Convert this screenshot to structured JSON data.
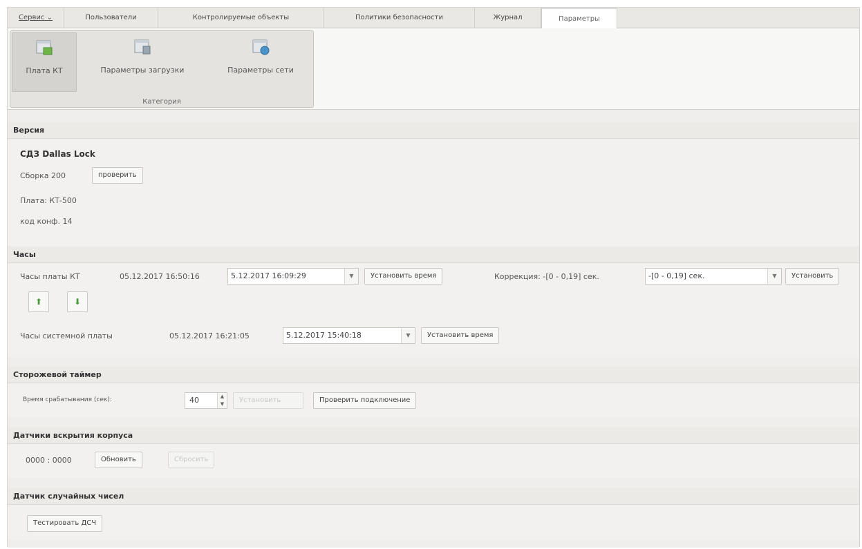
{
  "tabs": {
    "service": "Сервис",
    "users": "Пользователи",
    "objects": "Контролируемые объекты",
    "policies": "Политики безопасности",
    "journal": "Журнал",
    "params": "Параметры"
  },
  "ribbon": {
    "btn_board": "Плата КТ",
    "btn_boot": "Параметры загрузки",
    "btn_net": "Параметры сети",
    "group_caption": "Категория"
  },
  "version": {
    "title": "Версия",
    "product": "СДЗ Dallas Lock",
    "build": "Сборка 200",
    "check_button": "проверить",
    "board": "Плата: КТ-500",
    "config_code": "код конф. 14"
  },
  "clock": {
    "title": "Часы",
    "board_label": "Часы платы КТ",
    "board_time": "05.12.2017 16:50:16",
    "board_combo_value": "5.12.2017 16:09:29",
    "set_time_button": "Установить время",
    "correction_label": "Коррекция: -[0 - 0,19] сек.",
    "correction_combo_value": "-[0 - 0,19] сек.",
    "set_button": "Установить",
    "system_label": "Часы системной платы",
    "system_time": "05.12.2017 16:21:05",
    "system_combo_value": "5.12.2017 15:40:18",
    "system_set_time_button": "Установить время"
  },
  "watchdog": {
    "title": "Сторожевой таймер",
    "trigger_label": "Время срабатывания (сек):",
    "trigger_value": "40",
    "set_button": "Установить",
    "check_connection_button": "Проверить подключение"
  },
  "sensors": {
    "title": "Датчики вскрытия корпуса",
    "value": "0000 : 0000",
    "refresh_button": "Обновить",
    "reset_button": "Сбросить"
  },
  "rng": {
    "title": "Датчик случайных чисел",
    "test_button": "Тестировать ДСЧ"
  }
}
